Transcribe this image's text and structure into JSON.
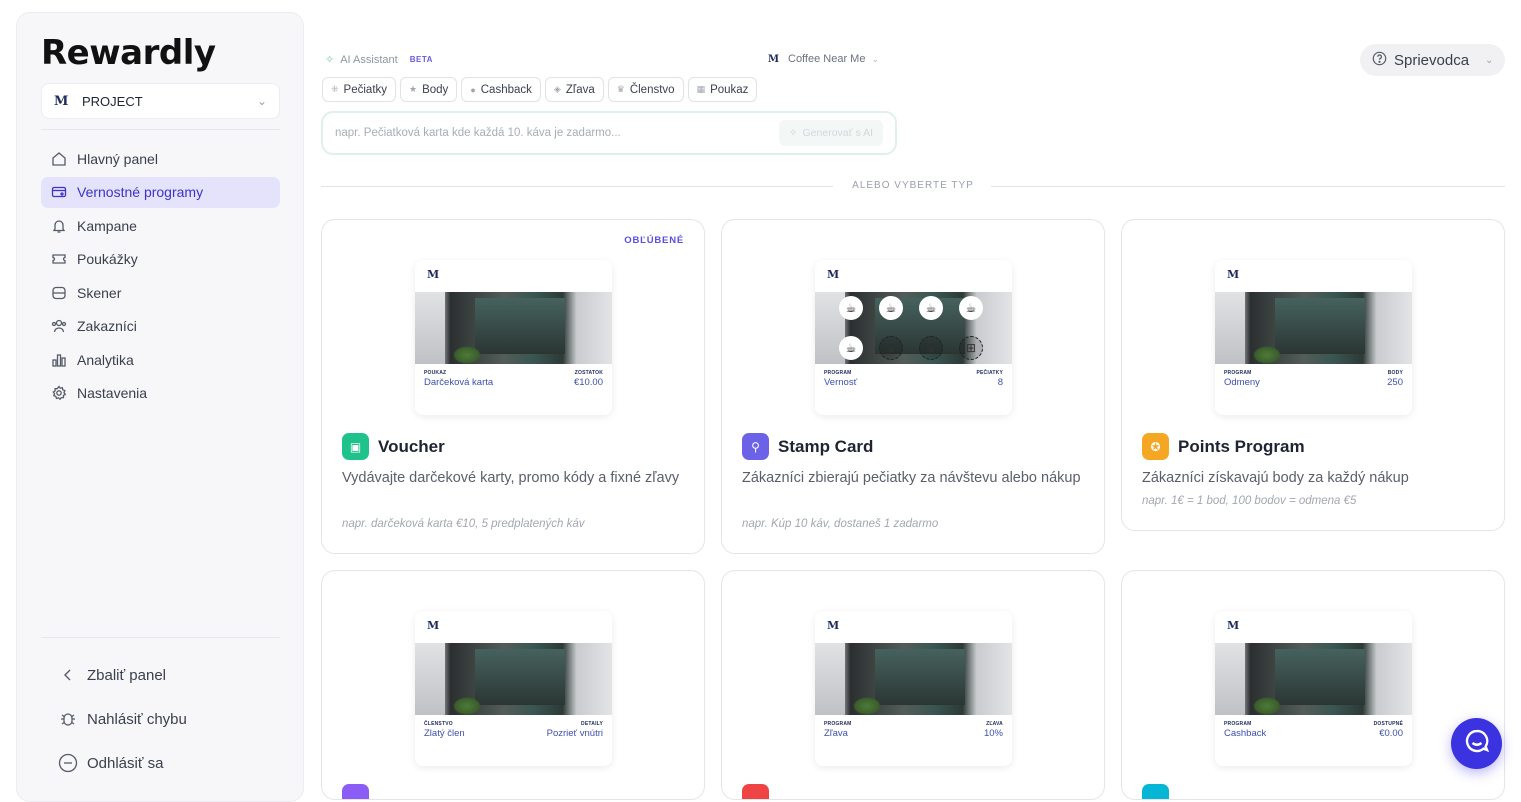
{
  "app": {
    "logo": "Rewardly"
  },
  "sidebar": {
    "project": {
      "monogram": "M",
      "label": "PROJECT"
    },
    "items": [
      {
        "label": "Hlavný panel",
        "icon": "home-icon"
      },
      {
        "label": "Vernostné programy",
        "icon": "card-icon",
        "active": true
      },
      {
        "label": "Kampane",
        "icon": "bell-icon"
      },
      {
        "label": "Poukážky",
        "icon": "ticket-icon"
      },
      {
        "label": "Skener",
        "icon": "scan-icon"
      },
      {
        "label": "Zakazníci",
        "icon": "users-icon"
      },
      {
        "label": "Analytika",
        "icon": "chart-icon"
      },
      {
        "label": "Nastavenia",
        "icon": "gear-icon"
      }
    ],
    "bottom": {
      "collapse": "Zbaliť panel",
      "report": "Nahlásiť chybu",
      "logout": "Odhlásiť sa"
    }
  },
  "header": {
    "ai_label": "AI Assistant",
    "ai_badge": "BETA",
    "place": "Coffee Near Me",
    "guide": "Sprievodca"
  },
  "chips": [
    "Pečiatky",
    "Body",
    "Cashback",
    "Zľava",
    "Členstvo",
    "Poukaz"
  ],
  "ai_input": {
    "placeholder": "napr. Pečiatková karta kde každá 10. káva je zadarmo...",
    "button": "Generovať s AI"
  },
  "divider_text": "ALEBO VYBERTE TYP",
  "cards": [
    {
      "badge": "OBĽÚBENÉ",
      "title": "Voucher",
      "tile_color": "#1fc28b",
      "description": "Vydávajte darčekové karty, promo kódy a fixné zľavy",
      "example": "napr. darčeková karta €10, 5 predplatených káv",
      "preview": {
        "left_key": "POUKAZ",
        "left_val": "Darčeková karta",
        "right_key": "ZOSTATOK",
        "right_val": "€10.00"
      }
    },
    {
      "title": "Stamp Card",
      "tile_color": "#6b62e8",
      "description": "Zákazníci zbierajú pečiatky za návštevu alebo nákup",
      "example": "napr. Kúp 10 káv, dostaneš 1 zadarmo",
      "preview": {
        "left_key": "PROGRAM",
        "left_val": "Vernosť",
        "right_key": "PEČIATKY",
        "right_val": "8",
        "stamps_filled": 5,
        "stamps_total": 8
      }
    },
    {
      "title": "Points Program",
      "tile_color": "#f5a623",
      "description": "Zákazníci získavajú body za každý nákup",
      "example": "napr. 1€ = 1 bod, 100 bodov = odmena €5",
      "preview": {
        "left_key": "PROGRAM",
        "left_val": "Odmeny",
        "right_key": "BODY",
        "right_val": "250"
      }
    },
    {
      "preview": {
        "left_key": "ČLENSTVO",
        "left_val": "Zlatý člen",
        "right_key": "DETAILY",
        "right_val": "Pozrieť vnútri"
      },
      "tile_color": "#8b5cf6"
    },
    {
      "preview": {
        "left_key": "PROGRAM",
        "left_val": "Zľava",
        "right_key": "ZĽAVA",
        "right_val": "10%"
      },
      "tile_color": "#ef4444"
    },
    {
      "preview": {
        "left_key": "PROGRAM",
        "left_val": "Cashback",
        "right_key": "DOSTUPNÉ",
        "right_val": "€0.00"
      },
      "tile_color": "#06b6d4"
    }
  ],
  "colors": {
    "accent": "#3d33c9",
    "active_bg": "#e4e3fb",
    "fab": "#3b33e0"
  }
}
